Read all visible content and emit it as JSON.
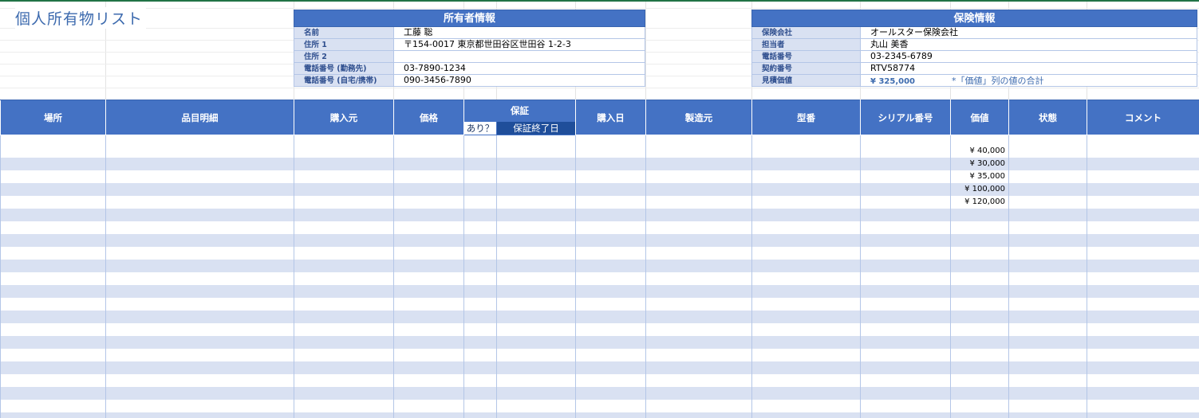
{
  "title": "個人所有物リスト",
  "owner_info": {
    "header": "所有者情報",
    "rows": [
      {
        "label": "名前",
        "value": "工藤 聡"
      },
      {
        "label": "住所 1",
        "value": "〒154-0017 東京都世田谷区世田谷 1-2-3"
      },
      {
        "label": "住所 2",
        "value": ""
      },
      {
        "label": "電話番号 (勤務先)",
        "value": "03-7890-1234"
      },
      {
        "label": "電話番号 (自宅/携帯)",
        "value": "090-3456-7890"
      }
    ]
  },
  "insurance_info": {
    "header": "保険情報",
    "rows": [
      {
        "label": "保険会社",
        "value": "オールスター保険会社"
      },
      {
        "label": "担当者",
        "value": "丸山 美香"
      },
      {
        "label": "電話番号",
        "value": "03-2345-6789"
      },
      {
        "label": "契約番号",
        "value": "RTV58774"
      }
    ],
    "estimate": {
      "label": "見積価値",
      "value": "¥ 325,000",
      "note": "*「価値」列の値の合計"
    }
  },
  "table": {
    "columns": [
      "場所",
      "品目明細",
      "購入元",
      "価格",
      "保証",
      "購入日",
      "製造元",
      "型番",
      "シリアル番号",
      "価値",
      "状態",
      "コメント"
    ],
    "warranty_sub": [
      "あり？",
      "保証終了日"
    ],
    "values": [
      "¥ 40,000",
      "¥ 30,000",
      "¥ 35,000",
      "¥ 100,000",
      "¥ 120,000"
    ],
    "row_count": 22
  }
}
